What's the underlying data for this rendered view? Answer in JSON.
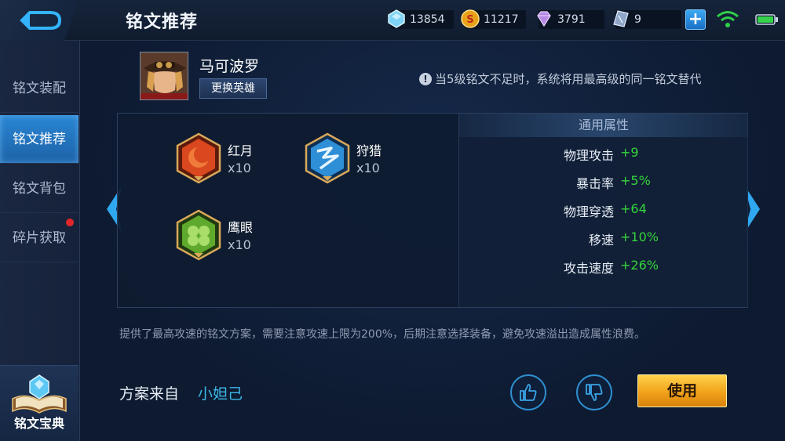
{
  "header": {
    "title": "铭文推荐",
    "resources": {
      "crystal": "13854",
      "gold": "11217",
      "diamond": "3791",
      "coupon": "9"
    }
  },
  "sidebar": {
    "items": [
      {
        "label": "铭文装配",
        "active": false
      },
      {
        "label": "铭文推荐",
        "active": true
      },
      {
        "label": "铭文背包",
        "active": false
      },
      {
        "label": "碎片获取",
        "active": false,
        "red_dot": true
      }
    ],
    "codex_label": "铭文宝典"
  },
  "hero": {
    "name": "马可波罗",
    "change_button": "更换英雄"
  },
  "notice": "当5级铭文不足时，系统将用最高级的同一铭文替代",
  "runes": [
    {
      "name": "红月",
      "count": "x10",
      "color": "#d9481e",
      "icon": "red-moon-rune-icon"
    },
    {
      "name": "狩猎",
      "count": "x10",
      "color": "#2f8fd6",
      "icon": "hunt-rune-icon"
    },
    {
      "name": "鹰眼",
      "count": "x10",
      "color": "#5fa92c",
      "icon": "hawk-eye-rune-icon"
    }
  ],
  "attributes": {
    "title": "通用属性",
    "rows": [
      {
        "name": "物理攻击",
        "value": "+9"
      },
      {
        "name": "暴击率",
        "value": "+5%"
      },
      {
        "name": "物理穿透",
        "value": "+64"
      },
      {
        "name": "移速",
        "value": "+10%"
      },
      {
        "name": "攻击速度",
        "value": "+26%"
      }
    ]
  },
  "description": "提供了最高攻速的铭文方案，需要注意攻速上限为200%，后期注意选择装备，避免攻速溢出造成属性浪费。",
  "scheme": {
    "label": "方案来自",
    "author": "小妲己"
  },
  "buttons": {
    "use": "使用"
  },
  "colors": {
    "accent_blue": "#2a86d4",
    "attr_green": "#35d43a",
    "author_cyan": "#3cb8e8",
    "use_gold": "#f0a21a"
  }
}
